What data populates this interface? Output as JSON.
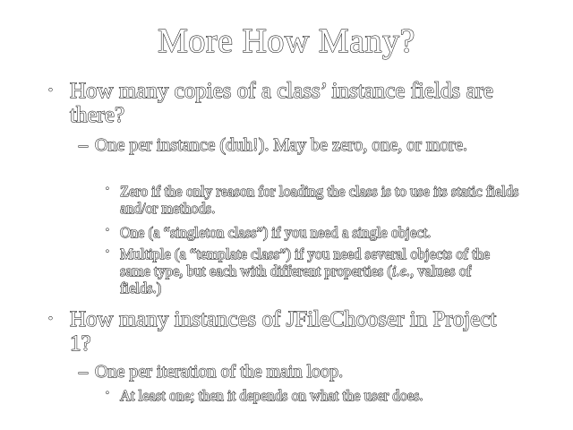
{
  "slide": {
    "title": "More How Many?",
    "bullets": [
      {
        "marker": "•",
        "text": "How many copies of a class’ instance fields are there?",
        "sub": [
          {
            "marker": "–",
            "text": "One per instance (duh!).  May be zero, one, or more.",
            "sub": [
              {
                "marker": "•",
                "text": "Zero if the only reason for loading the class is to use its static fields and/or methods."
              },
              {
                "marker": "•",
                "text": "One (a “singleton class”) if you need a single object."
              },
              {
                "marker": "•",
                "text_before": "Multiple (a “template class”) if you need several objects of the same type, but each with different properties (",
                "text_italic": "i.e.",
                "text_after": ", values of fields.)"
              }
            ]
          }
        ]
      },
      {
        "marker": "•",
        "text": "How many instances of JFileChooser in Project 1?",
        "sub": [
          {
            "marker": "–",
            "text": "One per iteration of the main loop.",
            "sub": [
              {
                "marker": "•",
                "text": "At least one; then it depends on what the user does."
              }
            ]
          }
        ]
      }
    ]
  }
}
